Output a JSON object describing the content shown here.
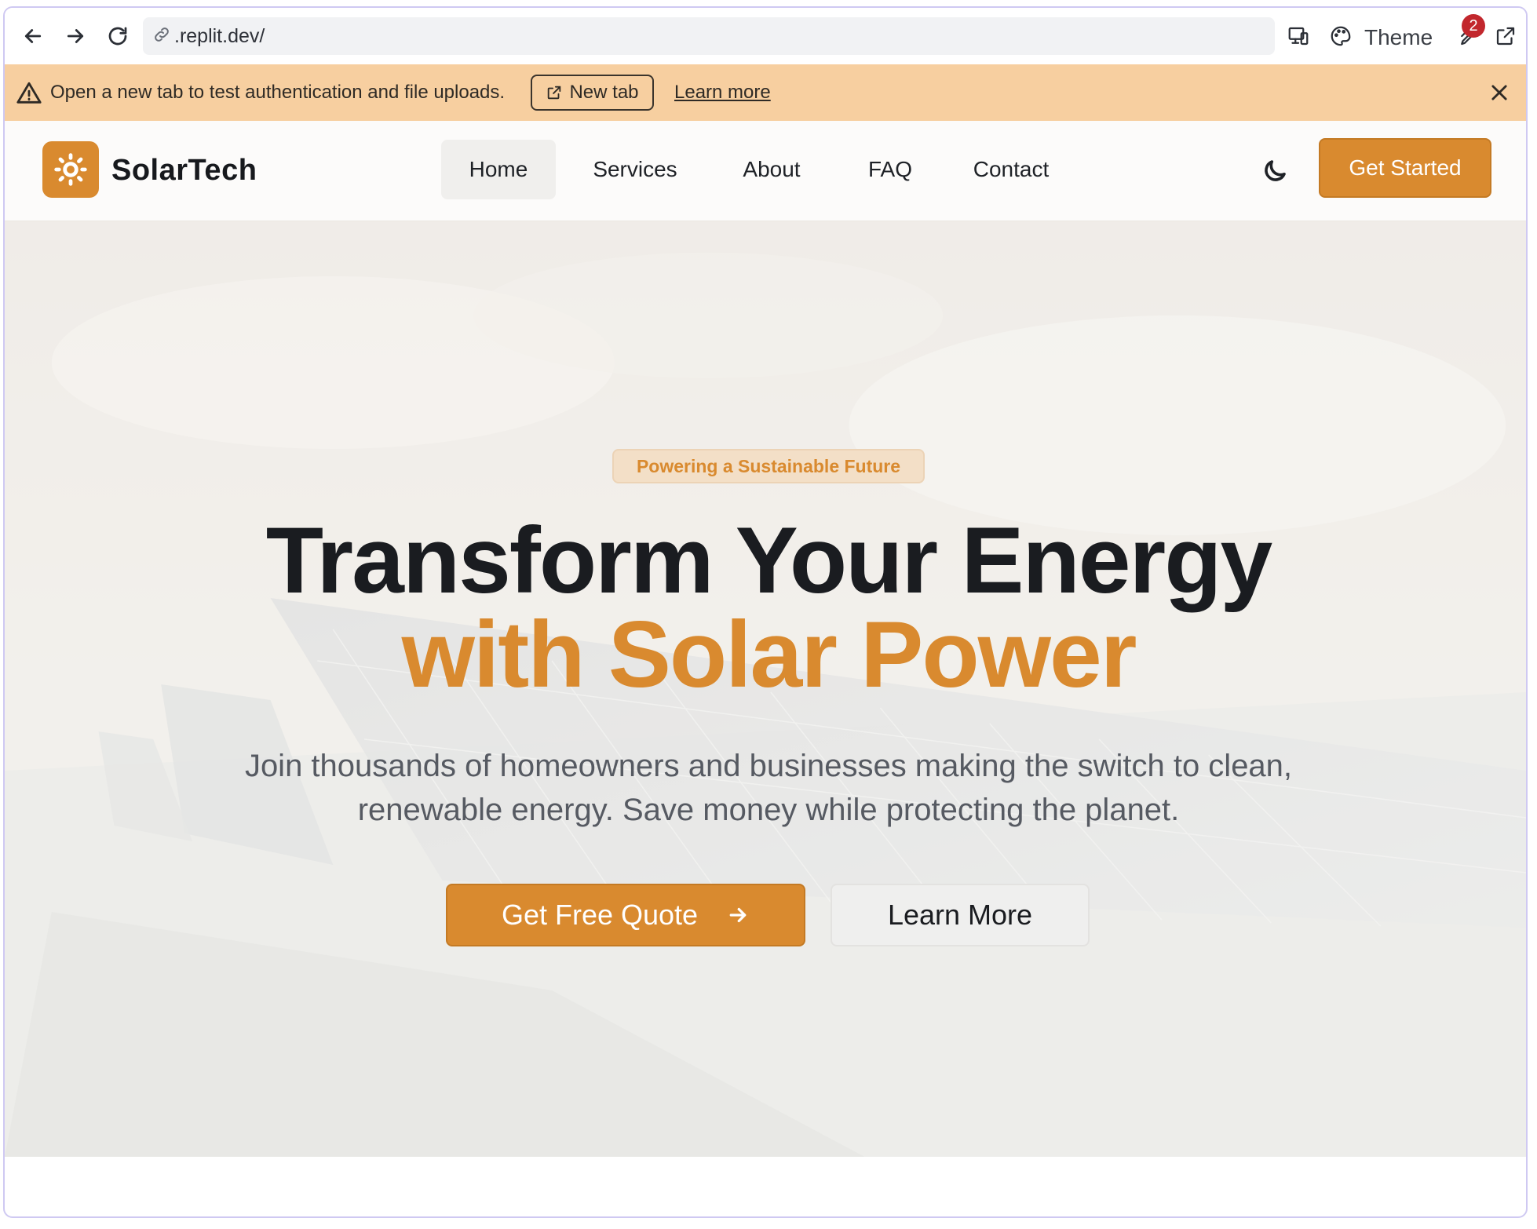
{
  "browser": {
    "url": ".replit.dev/",
    "theme_label": "Theme",
    "badge_count": "2",
    "icons": [
      "back-icon",
      "forward-icon",
      "reload-icon",
      "link-icon",
      "devices-icon",
      "palette-icon",
      "wrench-icon",
      "external-link-icon"
    ]
  },
  "notice": {
    "message": "Open a new tab to test authentication and file uploads.",
    "new_tab_label": "New tab",
    "learn_more_label": "Learn more"
  },
  "nav": {
    "brand": "SolarTech",
    "items": [
      {
        "label": "Home",
        "active": true
      },
      {
        "label": "Services",
        "active": false
      },
      {
        "label": "About",
        "active": false
      },
      {
        "label": "FAQ",
        "active": false
      },
      {
        "label": "Contact",
        "active": false
      }
    ],
    "cta_label": "Get Started"
  },
  "hero": {
    "tagline": "Powering a Sustainable Future",
    "headline": "Transform Your Energy",
    "headline_accent": "with Solar Power",
    "subtext": "Join thousands of homeowners and businesses making the switch to clean, renewable energy. Save money while protecting the planet.",
    "primary_button": "Get Free Quote",
    "secondary_button": "Learn More"
  },
  "colors": {
    "accent": "#d98a2f",
    "notice_bg": "#f7cfa0",
    "badge": "#c2272d",
    "headline": "#1a1c20"
  }
}
